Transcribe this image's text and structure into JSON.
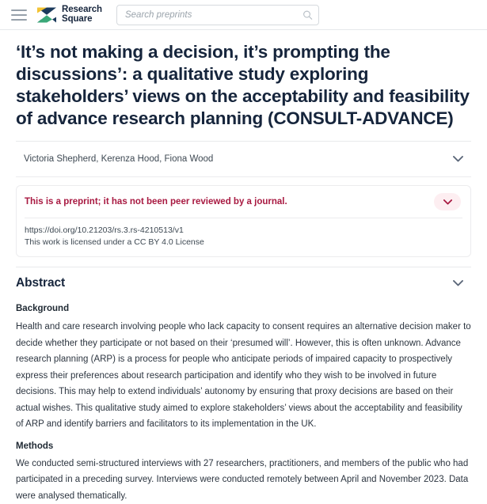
{
  "header": {
    "menu_icon": "hamburger-menu-icon",
    "brand": {
      "line1": "Research",
      "line2": "Square",
      "logo_icon": "research-square-logo-icon",
      "colors": {
        "yellow": "#f2c230",
        "navy": "#1b3a5c",
        "green": "#3aa878"
      }
    },
    "search": {
      "placeholder": "Search preprints",
      "value": "",
      "icon": "search-icon"
    }
  },
  "paper": {
    "title": "‘It’s not making a decision, it’s prompting the discussions’: a qualitative study exploring stakeholders’ views on the acceptability and feasibility of advance research planning (CONSULT-ADVANCE)",
    "authors": "Victoria Shepherd, Kerenza Hood, Fiona Wood",
    "authors_toggle_icon": "chevron-down-icon",
    "preprint_notice": "This is a preprint; it has not been peer reviewed by a journal.",
    "preprint_toggle_icon": "chevron-down-icon",
    "doi": "https://doi.org/10.21203/rs.3.rs-4210513/v1",
    "license": "This work is licensed under a CC BY 4.0 License",
    "notice_color": "#a81941"
  },
  "abstract": {
    "heading": "Abstract",
    "toggle_icon": "chevron-down-icon",
    "sections": [
      {
        "label": "Background",
        "body": "Health and care research involving people who lack capacity to consent requires an alternative decision maker to decide whether they participate or not based on their ‘presumed will’. However, this is often unknown. Advance research planning (ARP) is a process for people who anticipate periods of impaired capacity to prospectively express their preferences about research participation and identify who they wish to be involved in future decisions. This may help to extend individuals’ autonomy by ensuring that proxy decisions are based on their actual wishes. This qualitative study aimed to explore stakeholders’ views about the acceptability and feasibility of ARP and identify barriers and facilitators to its implementation in the UK."
      },
      {
        "label": "Methods",
        "body": "We conducted semi-structured interviews with 27 researchers, practitioners, and members of the public who had participated in a preceding survey. Interviews were conducted remotely between April and November 2023. Data were analysed thematically."
      }
    ]
  }
}
